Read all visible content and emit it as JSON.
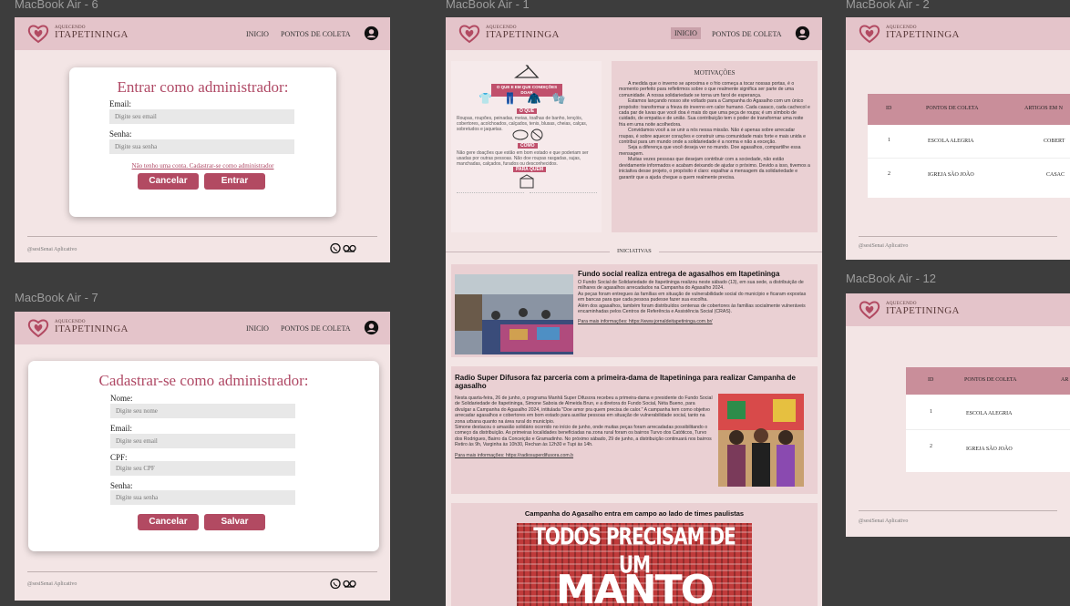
{
  "frames": {
    "f6": "MacBook Air - 6",
    "f7": "MacBook Air - 7",
    "f1": "MacBook Air - 1",
    "f2": "MacBook Air - 2",
    "f12": "MacBook Air - 12"
  },
  "brand": {
    "small": "AQUECENDO",
    "big": "ITAPETININGA"
  },
  "nav": {
    "inicio": "INICIO",
    "pontos": "PONTOS DE COLETA"
  },
  "login": {
    "title": "Entrar como administrador:",
    "email_label": "Email:",
    "email_placeholder": "Digite seu email",
    "senha_label": "Senha:",
    "senha_placeholder": "Digite sua senha",
    "link": "Não tenho uma conta. Cadastrar-se como administrador",
    "cancel": "Cancelar",
    "enter": "Entrar"
  },
  "signup": {
    "title": "Cadastrar-se como administrador:",
    "nome_label": "Nome:",
    "nome_placeholder": "Digite seu nome",
    "email_label": "Email:",
    "email_placeholder": "Digite seu email",
    "cpf_label": "CPF:",
    "cpf_placeholder": "Digite seu CPF",
    "senha_label": "Senha:",
    "senha_placeholder": "Digite sua senha",
    "cancel": "Cancelar",
    "save": "Salvar"
  },
  "footer": {
    "copyright": "@sesiSenai Aplicativo"
  },
  "home": {
    "infographic": {
      "heading": "O QUE E EM QUE CONDIÇÕES DOAR",
      "o_que": "O QUE",
      "como": "COMO",
      "para_quem": "PARA QUEM",
      "text1": "Roupas, roupões, peinadas, meias, toalhas de banho, lençóis, cobertores, acolchoados, calçados, tenis, blusas, cheias, calças, sobretudos e jaquetas.",
      "text2": "Não gere doações que estão em bom estado e que poderiam ser usadas por outras pessoas. Não doe roupas rasgadas, sujas, manchadas, calçados, furados ou desconhecidos."
    },
    "motivacoes_title": "MOTIVAÇÕES",
    "motivacoes_p1": "A medida que o inverno se aproxima e o frio começa a tocar nossas portas, é o momento perfeito para refletirmos sobre o que realmente significa ser parte de uma comunidade. A nossa solidariedade se torna um farol de esperança.",
    "motivacoes_p2": "Estamos lançando nosso site voltado para a Campanha do Agasalho com um único propósito: transformar a frieza do inverno em calor humano. Cada casaco, cada cachecol e cada par de luvas que você doa é mais do que uma peça de roupa; é um símbolo de cuidado, de empatia e de união. Sua contribuição tem o poder de transformar uma noite fria em uma noite acolhedora.",
    "motivacoes_p3": "Convidamos você a se unir a nós nessa missão. Não é apenas sobre arrecadar roupas, é sobre aquecer corações e construir uma comunidade mais forte e mais unida e contribui para um mundo onde a solidariedade é a norma e não a exceção.",
    "motivacoes_p4": "Seja a diferença que você deseja ver no mundo. Doe agasalhos, compartilhe essa mensagem.",
    "motivacoes_p5": "Muitas vezes pessoas que desejam contribuir com a sociedade, não estão devidamente informados e acabam deixando de ajudar o próximo. Devido a isso, tivemos a iniciativa desse projeto, o propósito é claro: espalhar a mensagem da solidariedade e garantir que a ajuda chegue a quem realmente precisa.",
    "iniciativas": "INICIATIVAS",
    "news1_title": "Fundo social realiza entrega de agasalhos em Itapetininga",
    "news1_p1": "O Fundo Social de Solidariedade de Itapetininga realizou neste sábado (13), em sua sede, a distribuição de milhares de agasalhos arrecadados na Campanha do Agasalho 2024.",
    "news1_p2": "As peças foram entregues às famílias em situação de vulnerabilidade social do município e ficaram expostas em bancas para que cada pessoa pudesse fazer sua escolha.",
    "news1_p3": "Além dos agasalhos, também foram distribuídos centenas de cobertores às famílias socialmente vulneráveis encaminhadas pelos Centros de Referência e Assistência Social (CRAS).",
    "news1_more": "Para mais informações: https://www.jornaldeitapetininga.com.br/",
    "news2_title": "Radio Super Difusora faz parceria com a primeira-dama de Itapetininga para realizar Campanha de agasalho",
    "news2_p1": "Nesta quarta-feira, 26 de junho, o programa Manhã Super Difusora recebeu a primeira-dama e presidente do Fundo Social de Solidariedade de Itapetininga, Simone Saboia de Almeida Brun, e a diretora do Fundo Social, Néta Bueno, para divulgar a Campanha do Agasalho 2024, intitulada \"Doe amor pra quem precisa de calor.\" A campanha tem como objetivo arrecadar agasalhos e cobertores em bom estado para auxiliar pessoas em situação de vulnerabilidade social, tanto na zona urbana quanto na área rural do município.",
    "news2_p2": "Simone destacou o amasião solidário ocorrido no início de junho, onde muitas peças foram arrecadadas possibilitando o começo da distribuição. As primeiras localidades beneficiadas na zona rural foram os bairros Turvo dos Catóticos, Turvo dos Rodrigues, Bairro da Conceição e Gramadinho. No próximo sábado, 29 de junho, a distribuição continuará nos bairros Retiro às 9h, Varginha às 10h30, Rechan às 12h30 e Tupi às 14h.",
    "news2_more": "Para mais informações: https://radiosuperdifusora.com.b",
    "news3_title": "Campanha do Agasalho entra em campo ao lado de times paulistas",
    "poster_line1": "TODOS PRECISAM DE UM",
    "poster_line2": "MANTO"
  },
  "table": {
    "col_id": "ID",
    "col_pontos": "PONTOS DE COLETA",
    "col_artigos": "ARTIGOS EM N",
    "col_artigos_short": "AR",
    "rows": [
      {
        "id": "1",
        "ponto": "ESCOLA ALEGRIA",
        "artigo": "COBERT"
      },
      {
        "id": "2",
        "ponto": "IGREJA SÃO JOÃO",
        "artigo": "CASAC"
      }
    ]
  }
}
